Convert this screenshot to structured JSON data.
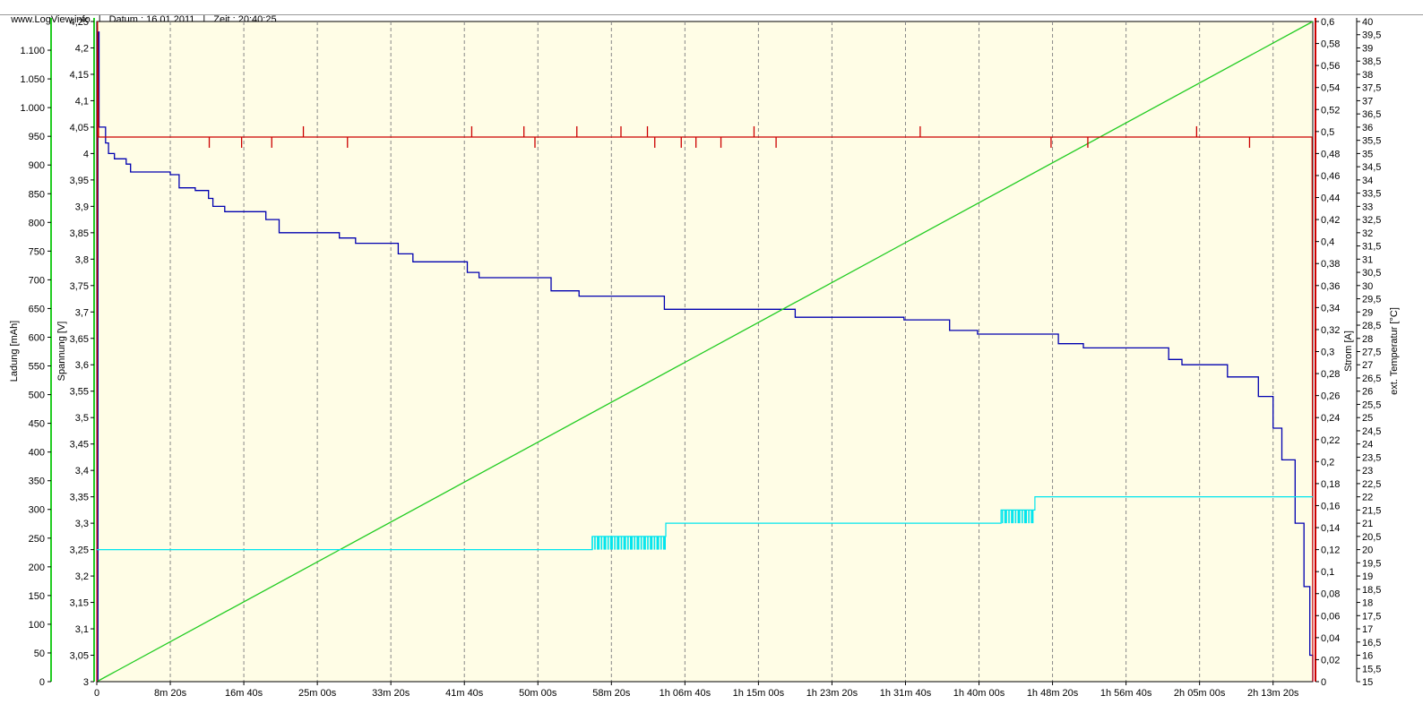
{
  "header": {
    "site": "www.LogView.info",
    "date_label": "Datum : 16.01.2011",
    "time_label": "Zeit : 20:40:25"
  },
  "colors": {
    "plot_bg": "#fffde6",
    "voltage": "#0000b0",
    "charge": "#22cc22",
    "current": "#cc0000",
    "temperature": "#00e5ee",
    "grid": "#888888"
  },
  "chart_data": {
    "type": "line",
    "x_unit": "seconds",
    "xlim": [
      0,
      8270
    ],
    "x_ticks": [
      {
        "v": 0,
        "label": "0"
      },
      {
        "v": 500,
        "label": "8m 20s"
      },
      {
        "v": 1000,
        "label": "16m 40s"
      },
      {
        "v": 1500,
        "label": "25m 00s"
      },
      {
        "v": 2000,
        "label": "33m 20s"
      },
      {
        "v": 2500,
        "label": "41m 40s"
      },
      {
        "v": 3000,
        "label": "50m 00s"
      },
      {
        "v": 3500,
        "label": "58m 20s"
      },
      {
        "v": 4000,
        "label": "1h 06m 40s"
      },
      {
        "v": 4500,
        "label": "1h 15m 00s"
      },
      {
        "v": 5000,
        "label": "1h 23m 20s"
      },
      {
        "v": 5500,
        "label": "1h 31m 40s"
      },
      {
        "v": 6000,
        "label": "1h 40m 00s"
      },
      {
        "v": 6500,
        "label": "1h 48m 20s"
      },
      {
        "v": 7000,
        "label": "1h 56m 40s"
      },
      {
        "v": 7500,
        "label": "2h 05m 00s"
      },
      {
        "v": 8000,
        "label": "2h 13m 20s"
      }
    ],
    "axes": {
      "charge": {
        "label": "Ladung [mAh]",
        "range": [
          0,
          1150
        ],
        "ticks": [
          0,
          50,
          100,
          150,
          200,
          250,
          300,
          350,
          400,
          450,
          500,
          550,
          600,
          650,
          700,
          750,
          800,
          850,
          900,
          950,
          1000,
          1050,
          1100
        ],
        "tick_labels": [
          "0",
          "50",
          "100",
          "150",
          "200",
          "250",
          "300",
          "350",
          "400",
          "450",
          "500",
          "550",
          "600",
          "650",
          "700",
          "750",
          "800",
          "850",
          "900",
          "950",
          "1.000",
          "1.050",
          "1.100"
        ]
      },
      "voltage": {
        "label": "Spannung [V]",
        "range": [
          3.0,
          4.25
        ],
        "tick_labels": [
          "3",
          "3,05",
          "3,1",
          "3,15",
          "3,2",
          "3,25",
          "3,3",
          "3,35",
          "3,4",
          "3,45",
          "3,5",
          "3,55",
          "3,6",
          "3,65",
          "3,7",
          "3,75",
          "3,8",
          "3,85",
          "3,9",
          "3,95",
          "4",
          "4,05",
          "4,1",
          "4,15",
          "4,2",
          "4,25"
        ]
      },
      "current": {
        "label": "Strom [A]",
        "range": [
          0,
          0.6
        ],
        "tick_labels": [
          "0",
          "0,02",
          "0,04",
          "0,06",
          "0,08",
          "0,1",
          "0,12",
          "0,14",
          "0,16",
          "0,18",
          "0,2",
          "0,22",
          "0,24",
          "0,26",
          "0,28",
          "0,3",
          "0,32",
          "0,34",
          "0,36",
          "0,38",
          "0,4",
          "0,42",
          "0,44",
          "0,46",
          "0,48",
          "0,5",
          "0,52",
          "0,54",
          "0,56",
          "0,58",
          "0,6"
        ]
      },
      "temperature": {
        "label": "ext. Temperatur [°C]",
        "range": [
          15,
          40
        ],
        "tick_labels": [
          "15",
          "15,5",
          "16",
          "16,5",
          "17",
          "17,5",
          "18",
          "18,5",
          "19",
          "19,5",
          "20",
          "20,5",
          "21",
          "21,5",
          "22",
          "22,5",
          "23",
          "23,5",
          "24",
          "24,5",
          "25",
          "25,5",
          "26",
          "26,5",
          "27",
          "27,5",
          "28",
          "28,5",
          "29",
          "29,5",
          "30",
          "30,5",
          "31",
          "31,5",
          "32",
          "32,5",
          "33",
          "33,5",
          "34",
          "34,5",
          "35",
          "35,5",
          "36",
          "36,5",
          "37",
          "37,5",
          "38",
          "38,5",
          "39",
          "39,5",
          "40"
        ]
      }
    },
    "series": [
      {
        "name": "Spannung",
        "axis": "voltage",
        "points": [
          [
            0,
            3.0
          ],
          [
            8,
            4.23
          ],
          [
            15,
            4.05
          ],
          [
            60,
            4.02
          ],
          [
            80,
            4.0
          ],
          [
            120,
            3.99
          ],
          [
            200,
            3.98
          ],
          [
            230,
            3.965
          ],
          [
            500,
            3.96
          ],
          [
            560,
            3.935
          ],
          [
            670,
            3.93
          ],
          [
            760,
            3.915
          ],
          [
            790,
            3.9
          ],
          [
            870,
            3.89
          ],
          [
            1110,
            3.89
          ],
          [
            1150,
            3.875
          ],
          [
            1240,
            3.85
          ],
          [
            1600,
            3.85
          ],
          [
            1650,
            3.84
          ],
          [
            1760,
            3.83
          ],
          [
            1990,
            3.83
          ],
          [
            2050,
            3.81
          ],
          [
            2150,
            3.795
          ],
          [
            2440,
            3.795
          ],
          [
            2520,
            3.775
          ],
          [
            2600,
            3.765
          ],
          [
            2990,
            3.765
          ],
          [
            3090,
            3.74
          ],
          [
            3280,
            3.73
          ],
          [
            3740,
            3.73
          ],
          [
            3860,
            3.705
          ],
          [
            4560,
            3.705
          ],
          [
            4750,
            3.69
          ],
          [
            5490,
            3.685
          ],
          [
            5800,
            3.665
          ],
          [
            5990,
            3.658
          ],
          [
            6410,
            3.658
          ],
          [
            6540,
            3.64
          ],
          [
            6710,
            3.632
          ],
          [
            7220,
            3.632
          ],
          [
            7290,
            3.61
          ],
          [
            7380,
            3.6
          ],
          [
            7620,
            3.6
          ],
          [
            7690,
            3.577
          ],
          [
            7850,
            3.577
          ],
          [
            7900,
            3.54
          ],
          [
            8000,
            3.48
          ],
          [
            8060,
            3.42
          ],
          [
            8150,
            3.3
          ],
          [
            8210,
            3.18
          ],
          [
            8250,
            3.05
          ],
          [
            8270,
            3.0
          ]
        ]
      },
      {
        "name": "Ladung",
        "axis": "charge",
        "points": [
          [
            0,
            0
          ],
          [
            8270,
            1150
          ]
        ]
      },
      {
        "name": "Strom",
        "axis": "current",
        "points": [
          [
            0,
            0
          ],
          [
            5,
            0.6
          ],
          [
            12,
            0.495
          ],
          [
            8265,
            0.495
          ],
          [
            8270,
            0
          ]
        ],
        "spikes": [
          [
            765,
            -1
          ],
          [
            985,
            -1
          ],
          [
            1190,
            -1
          ],
          [
            1405,
            1
          ],
          [
            1705,
            -1
          ],
          [
            2550,
            1
          ],
          [
            2905,
            1
          ],
          [
            2980,
            -1
          ],
          [
            3265,
            1
          ],
          [
            3565,
            1
          ],
          [
            3745,
            1
          ],
          [
            3795,
            -1
          ],
          [
            3975,
            -1
          ],
          [
            4075,
            -1
          ],
          [
            4245,
            -1
          ],
          [
            4470,
            1
          ],
          [
            4620,
            -1
          ],
          [
            5600,
            1
          ],
          [
            6490,
            -1
          ],
          [
            6740,
            -1
          ],
          [
            7480,
            1
          ],
          [
            7840,
            -1
          ]
        ]
      },
      {
        "name": "ext. Temperatur",
        "axis": "temperature",
        "points": [
          [
            0,
            20.0
          ],
          [
            3370,
            20.0
          ],
          [
            3370,
            20.5
          ],
          [
            3870,
            20.5
          ],
          [
            3870,
            21.0
          ],
          [
            6150,
            21.0
          ],
          [
            6150,
            21.5
          ],
          [
            6380,
            21.5
          ],
          [
            6380,
            22.0
          ],
          [
            8270,
            22.0
          ]
        ],
        "noise_ranges": [
          [
            3370,
            3880,
            20.0,
            20.5
          ],
          [
            6150,
            6380,
            21.0,
            21.5
          ]
        ]
      }
    ]
  }
}
